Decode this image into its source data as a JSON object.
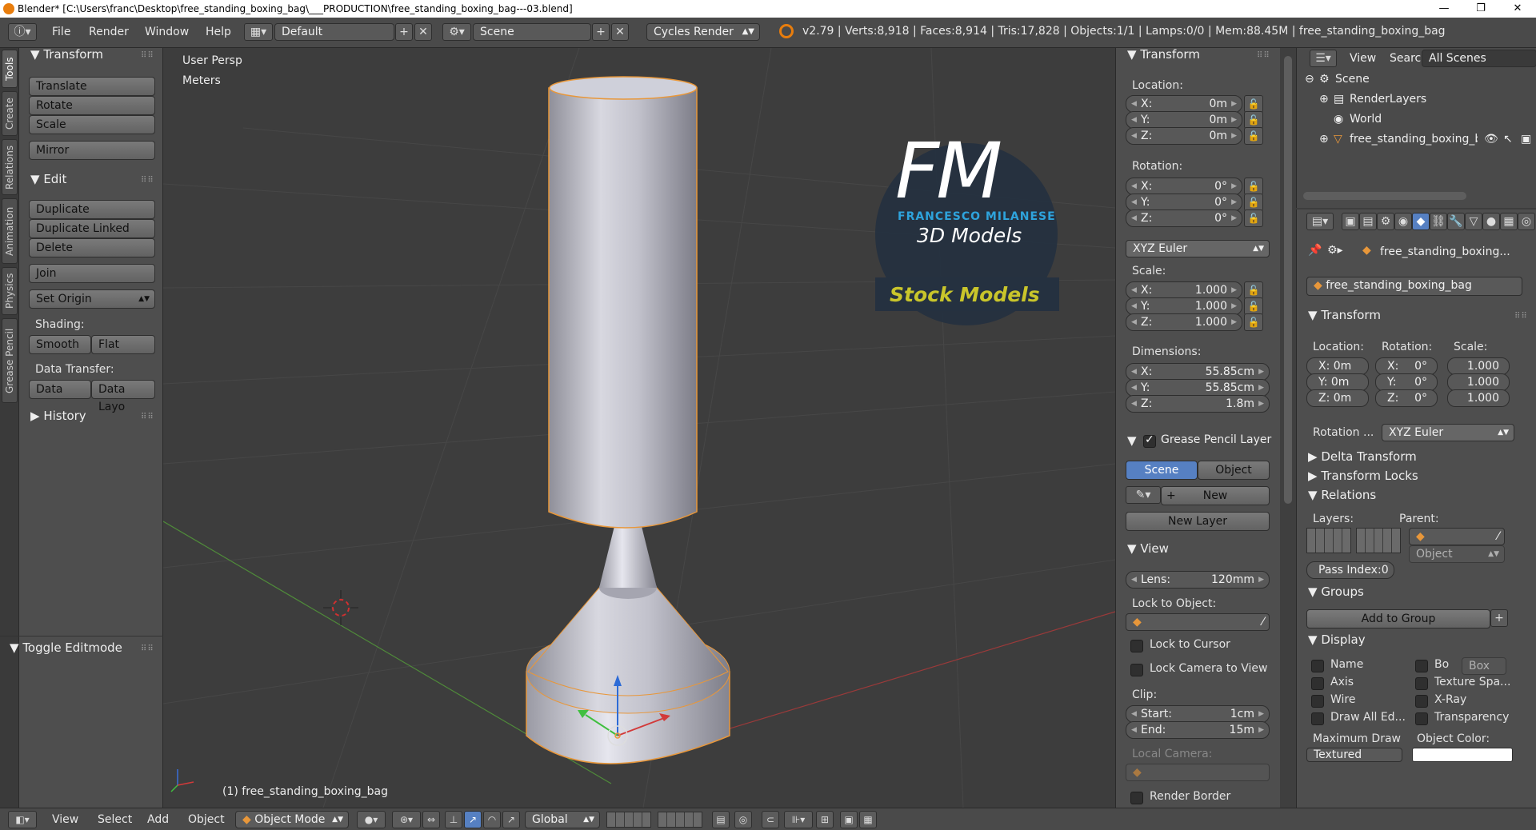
{
  "window": {
    "title": "Blender* [C:\\Users\\franc\\Desktop\\free_standing_boxing_bag\\___PRODUCTION\\free_standing_boxing_bag---03.blend]",
    "min_label": "—",
    "max_label": "❐",
    "close_label": "✕"
  },
  "menubar": {
    "menus": [
      "File",
      "Render",
      "Window",
      "Help"
    ],
    "layout": "Default",
    "scene": "Scene",
    "engine": "Cycles Render",
    "stats": "v2.79 | Verts:8,918 | Faces:8,914 | Tris:17,828 | Objects:1/1 | Lamps:0/0 | Mem:88.45M | free_standing_boxing_bag"
  },
  "tabs": [
    "Tools",
    "Create",
    "Relations",
    "Animation",
    "Physics",
    "Grease Pencil"
  ],
  "toolshelf": {
    "transform_header": "Transform",
    "translate": "Translate",
    "rotate": "Rotate",
    "scale": "Scale",
    "mirror": "Mirror",
    "edit_header": "Edit",
    "duplicate": "Duplicate",
    "duplicate_linked": "Duplicate Linked",
    "delete": "Delete",
    "join": "Join",
    "set_origin": "Set Origin",
    "shading_label": "Shading:",
    "smooth": "Smooth",
    "flat": "Flat",
    "data_transfer_label": "Data Transfer:",
    "data": "Data",
    "data_layout": "Data Layo",
    "history_header": "History",
    "toggle_editmode": "Toggle Editmode"
  },
  "viewport": {
    "view_name": "User Persp",
    "units": "Meters",
    "object_label": "(1) free_standing_boxing_bag",
    "watermark_fm": "FM",
    "watermark_name": "FRANCESCO MILANESE",
    "watermark_3d": "3D Models",
    "watermark_stock": "Stock Models"
  },
  "npanel": {
    "transform_header": "Transform",
    "location_label": "Location:",
    "loc_x": "0m",
    "loc_y": "0m",
    "loc_z": "0m",
    "rotation_label": "Rotation:",
    "rot_x": "0°",
    "rot_y": "0°",
    "rot_z": "0°",
    "rotation_mode": "XYZ Euler",
    "scale_label": "Scale:",
    "scale_x": "1.000",
    "scale_y": "1.000",
    "scale_z": "1.000",
    "dimensions_label": "Dimensions:",
    "dim_x": "55.85cm",
    "dim_y": "55.85cm",
    "dim_z": "1.8m",
    "grease_header": "Grease Pencil Layer",
    "gp_scene": "Scene",
    "gp_object": "Object",
    "gp_new": "New",
    "gp_new_layer": "New Layer",
    "view_header": "View",
    "lens_label": "Lens:",
    "lens_value": "120mm",
    "lock_to_object_label": "Lock to Object:",
    "lock_to_cursor": "Lock to Cursor",
    "lock_camera": "Lock Camera to View",
    "clip_label": "Clip:",
    "clip_start_label": "Start:",
    "clip_start": "1cm",
    "clip_end_label": "End:",
    "clip_end": "15m",
    "local_camera_label": "Local Camera:",
    "render_border": "Render Border",
    "axis_x": "X:",
    "axis_y": "Y:",
    "axis_z": "Z:"
  },
  "outliner": {
    "view": "View",
    "search": "Search",
    "filter": "All Scenes",
    "items": [
      "Scene",
      "RenderLayers",
      "World",
      "free_standing_boxing_bag"
    ]
  },
  "properties": {
    "object_path": "free_standing_boxing...",
    "object_name": "free_standing_boxing_bag",
    "transform_header": "Transform",
    "location_label": "Location:",
    "rotation_label": "Rotation:",
    "scale_label": "Scale:",
    "loc_x": "X: 0m",
    "loc_y": "Y: 0m",
    "loc_z": "Z: 0m",
    "rot_x": "X:",
    "rot_y": "Y:",
    "rot_z": "Z:",
    "rot_val": "0°",
    "scale_val": "1.000",
    "rotation_mode_label": "Rotation ...",
    "rotation_mode": "XYZ Euler",
    "delta_transform": "Delta Transform",
    "transform_locks": "Transform Locks",
    "relations": "Relations",
    "layers_label": "Layers:",
    "parent_label": "Parent:",
    "parent_type": "Object",
    "pass_index": "Pass Index:0",
    "groups": "Groups",
    "add_to_group": "Add to Group",
    "display": "Display",
    "name": "Name",
    "bo": "Bo",
    "box": "Box",
    "axis": "Axis",
    "texture_space": "Texture Spa...",
    "wire": "Wire",
    "xray": "X-Ray",
    "draw_all_edges": "Draw All Ed...",
    "transparency": "Transparency",
    "maximum_draw": "Maximum Draw",
    "object_color": "Object Color:",
    "textured": "Textured"
  },
  "bottombar": {
    "menus": [
      "View",
      "Select",
      "Add",
      "Object"
    ],
    "mode": "Object Mode",
    "orientation": "Global"
  },
  "colors": {
    "accent": "#5680c2",
    "object_outline": "#e8973a",
    "grid_x": "#9a3a3a",
    "grid_y": "#4f8a3a"
  }
}
